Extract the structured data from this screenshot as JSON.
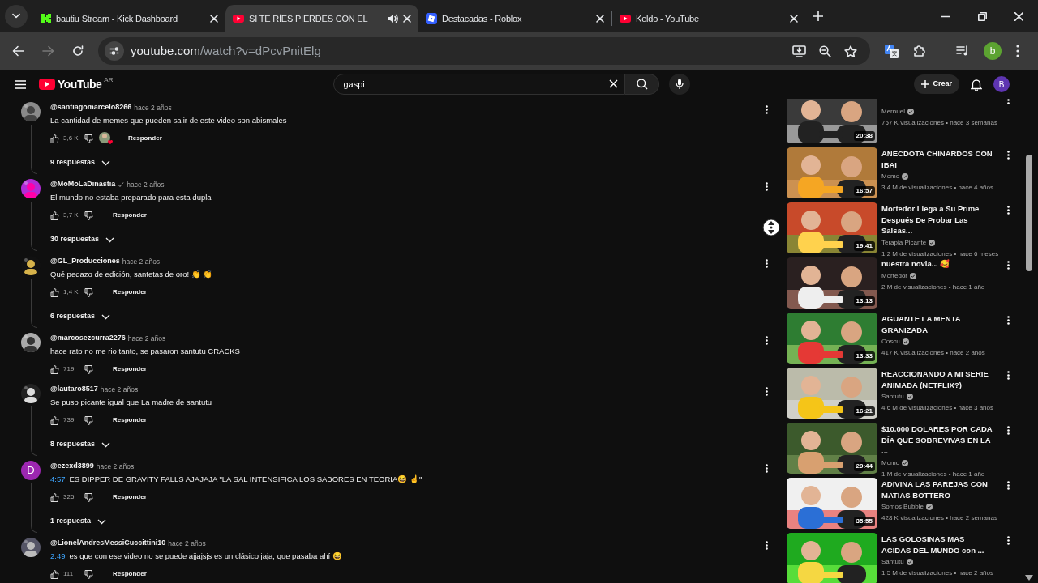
{
  "browser": {
    "tabs": [
      {
        "kind": "kick",
        "title": "bautiu Stream - Kick Dashboard",
        "selected": false,
        "audio": false
      },
      {
        "kind": "youtube",
        "title": "SI TE RÍES PIERDES CON EL",
        "selected": true,
        "audio": true
      },
      {
        "kind": "roblox",
        "title": "Destacadas - Roblox",
        "selected": false,
        "audio": false
      },
      {
        "kind": "youtube",
        "title": "Keldo - YouTube",
        "selected": false,
        "audio": false
      }
    ],
    "toolbar": {
      "forward_disabled": true,
      "url_host": "youtube.com",
      "url_path": "/watch?v=dPcvPnitElg",
      "profile_letter": "b"
    }
  },
  "masthead": {
    "logo": "YouTube",
    "country": "AR",
    "search": {
      "value": "gaspi"
    },
    "create_label": "Crear",
    "avatar_letter": "B"
  },
  "comments": [
    {
      "author": "@santiagomarcelo8266",
      "verified": false,
      "time": "hace 2 años",
      "text": "La cantidad de memes que pueden salir de este video son abismales",
      "likes": "3,6 K",
      "hearted": true,
      "reply_label": "Responder",
      "replies": "9 respuestas"
    },
    {
      "author": "@MoMoLaDinastia",
      "verified": true,
      "time": "hace 2 años",
      "text": "El mundo no estaba preparado para esta dupla",
      "likes": "3,7 K",
      "hearted": false,
      "reply_label": "Responder",
      "replies": "30 respuestas"
    },
    {
      "author": "@GL_Producciones",
      "verified": false,
      "time": "hace 2 años",
      "text": "Qué pedazo de edición, santetas de oro! 👏 👏",
      "likes": "1,4 K",
      "hearted": false,
      "reply_label": "Responder",
      "replies": "6 respuestas"
    },
    {
      "author": "@marcosezcurra2276",
      "verified": false,
      "time": "hace 2 años",
      "text": "hace rato no me rio tanto, se pasaron santutu CRACKS",
      "likes": "719",
      "hearted": false,
      "reply_label": "Responder"
    },
    {
      "author": "@lautaro8517",
      "verified": false,
      "time": "hace 2 años",
      "text": "Se puso picante igual que La madre de santutu",
      "likes": "739",
      "hearted": false,
      "reply_label": "Responder",
      "replies": "8 respuestas"
    },
    {
      "author": "@ezexd3899",
      "verified": false,
      "time": "hace 2 años",
      "timestamp": "4:57",
      "text": "ES DIPPER DE GRAVITY FALLS AJAJAJA \"LA SAL INTENSIFICA LOS SABORES EN TEORIA😆 ☝️\"",
      "likes": "325",
      "hearted": false,
      "reply_label": "Responder",
      "replies": "1 respuesta",
      "avatar": {
        "kind": "letter",
        "letter": "D",
        "color": "#9c27b0"
      }
    },
    {
      "author": "@LionelAndresMessiCuccittini10",
      "verified": false,
      "time": "hace 2 años",
      "timestamp": "2:49",
      "text": "es que con ese video no se puede ajjajsjs es un clásico jaja, que pasaba ahí 😆",
      "likes": "111",
      "hearted": false,
      "reply_label": "Responder"
    }
  ],
  "related": [
    {
      "channel": "Mernuel",
      "meta": "757 K visualizaciones • hace 3 semanas",
      "duration": "20:38"
    },
    {
      "title": "ANECDOTA CHINARDOS CON IBAI",
      "channel": "Momo",
      "meta": "3,4 M de visualizaciones • hace 4 años",
      "duration": "16:57"
    },
    {
      "title": "Mortedor Llega a Su Prime Después De Probar Las Salsas...",
      "channel": "Terapia Picante",
      "meta": "1,2 M de visualizaciones • hace 6 meses",
      "duration": "19:41"
    },
    {
      "title": "nuestra novia... 🥰",
      "channel": "Mortedor",
      "meta": "2 M de visualizaciones • hace 1 año",
      "duration": "13:13"
    },
    {
      "title": "AGUANTE LA MENTA GRANIZADA",
      "channel": "Coscu",
      "meta": "417 K visualizaciones • hace 2 años",
      "duration": "13:33"
    },
    {
      "title": "REACCIONANDO A MI SERIE ANIMADA (NETFLIX?)",
      "channel": "Santutu",
      "meta": "4,6 M de visualizaciones • hace 3 años",
      "duration": "16:21"
    },
    {
      "title": "$10.000 DOLARES POR CADA DÍA QUE SOBREVIVAS EN LA ...",
      "channel": "Momo",
      "meta": "1 M de visualizaciones • hace 1 año",
      "duration": "29:44"
    },
    {
      "title": "ADIVINA LAS PAREJAS CON MATIAS BOTTERO",
      "channel": "Somos Bubble",
      "meta": "428 K visualizaciones • hace 2 semanas",
      "duration": "35:55"
    },
    {
      "title": "LAS GOLOSINAS MAS ACIDAS DEL MUNDO con ...",
      "channel": "Santutu",
      "meta": "1,5 M de visualizaciones • hace 2 años"
    }
  ]
}
